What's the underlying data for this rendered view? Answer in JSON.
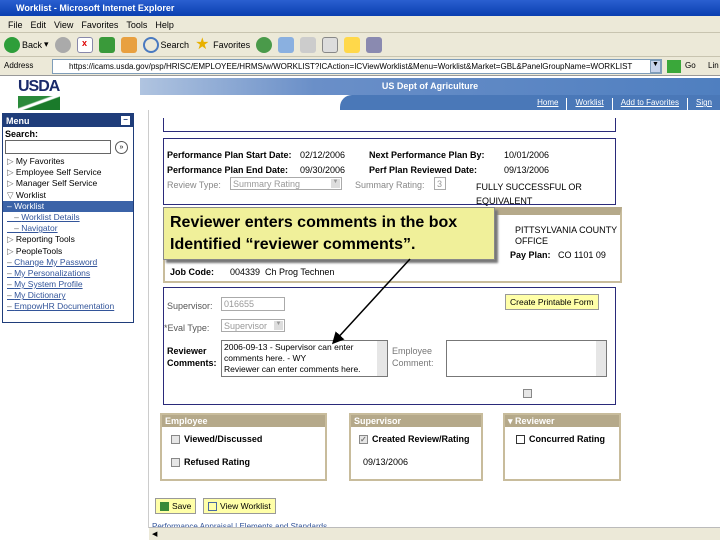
{
  "window": {
    "title": "Worklist - Microsoft Internet Explorer"
  },
  "menubar": [
    "File",
    "Edit",
    "View",
    "Favorites",
    "Tools",
    "Help"
  ],
  "toolbar": {
    "back": "Back",
    "search": "Search",
    "favorites": "Favorites"
  },
  "address": {
    "label": "Address",
    "url": "https://icams.usda.gov/psp/HRISC/EMPLOYEE/HRMS/w/WORKLIST?ICAction=ICViewWorklist&Menu=Worklist&Market=GBL&PanelGroupName=WORKLIST",
    "go": "Go",
    "links": "Lin"
  },
  "header": {
    "logo": "USDA",
    "title": "US Dept of Agriculture",
    "nav": [
      "Home",
      "Worklist",
      "Add to Favorites",
      "Sign"
    ]
  },
  "sidebar": {
    "title": "Menu",
    "search_label": "Search:",
    "items": [
      {
        "label": "My Favorites",
        "type": "folder"
      },
      {
        "label": "Employee Self Service",
        "type": "folder"
      },
      {
        "label": "Manager Self Service",
        "type": "folder"
      },
      {
        "label": "Worklist",
        "type": "open"
      },
      {
        "label": "– Worklist",
        "type": "sel"
      },
      {
        "label": "Worklist Details",
        "type": "sub"
      },
      {
        "label": "Navigator",
        "type": "sub"
      },
      {
        "label": "Reporting Tools",
        "type": "folder"
      },
      {
        "label": "PeopleTools",
        "type": "folder"
      },
      {
        "label": "Change My Password",
        "type": "link"
      },
      {
        "label": "My Personalizations",
        "type": "link"
      },
      {
        "label": "My System Profile",
        "type": "link"
      },
      {
        "label": "My Dictionary",
        "type": "link"
      },
      {
        "label": "EmpowHR Documentation",
        "type": "link"
      }
    ]
  },
  "plan": {
    "start_label": "Performance Plan Start Date:",
    "start": "02/12/2006",
    "end_label": "Performance Plan End Date:",
    "end": "09/30/2006",
    "next_label": "Next Performance Plan By:",
    "next": "10/01/2006",
    "reviewed_label": "Perf Plan Reviewed Date:",
    "reviewed": "09/13/2006",
    "review_type_label": "Review Type:",
    "review_type": "Summary Rating",
    "summary_label": "Summary Rating:",
    "summary": "3",
    "summary_desc": "FULLY SUCCESSFUL OR EQUIVALENT"
  },
  "job": {
    "office": "PITTSYLVANIA COUNTY OFFICE",
    "pay_plan_label": "Pay Plan:",
    "pay_plan": "CO 1101 09",
    "job_code_label": "Job Code:",
    "job_code": "004339",
    "job_title": "Ch Prog Technen"
  },
  "callout": {
    "line1": "Reviewer enters comments in the box",
    "line2": "Identified “reviewer comments”."
  },
  "eval": {
    "supervisor_label": "Supervisor:",
    "supervisor": "016655",
    "eval_type_label": "*Eval Type:",
    "eval_type": "Supervisor",
    "reviewer_label": "Reviewer Comments:",
    "reviewer_comments": "2006-09-13 - Supervisor can enter comments here. - WY\nReviewer can enter comments here.",
    "employee_label": "Employee Comment:",
    "employee_comment": "",
    "print_button": "Create Printable Form"
  },
  "panels": {
    "employee": {
      "title": "Employee",
      "viewed": "Viewed/Discussed",
      "refused": "Refused Rating"
    },
    "supervisor": {
      "title": "Supervisor",
      "created": "Created Review/Rating",
      "date": "09/13/2006"
    },
    "reviewer": {
      "title": "Reviewer",
      "concurred": "Concurred Rating"
    }
  },
  "buttons": {
    "save": "Save",
    "view_worklist": "View Worklist"
  },
  "footer_link": "Performance Appraisal | Elements and Standards"
}
